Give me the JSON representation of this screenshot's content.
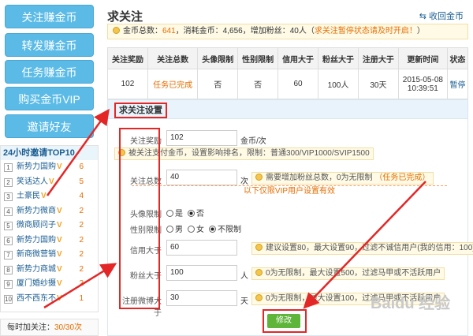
{
  "sidebar": {
    "buttons": [
      "关注赚金币",
      "转发赚金币",
      "任务赚金币",
      "购买金币VIP",
      "邀请好友"
    ],
    "top10_title": "24小时邀请TOP10",
    "top10": [
      {
        "rank": "1",
        "name": "新势力国购",
        "count": "6"
      },
      {
        "rank": "2",
        "name": "笑话达人",
        "count": "5"
      },
      {
        "rank": "3",
        "name": "土豪民",
        "count": "4"
      },
      {
        "rank": "4",
        "name": "新势力微商",
        "count": "2"
      },
      {
        "rank": "5",
        "name": "微商顾问子",
        "count": "2"
      },
      {
        "rank": "6",
        "name": "新势力国购",
        "count": "2"
      },
      {
        "rank": "7",
        "name": "新商微营销",
        "count": "2"
      },
      {
        "rank": "8",
        "name": "新势力商城",
        "count": "2"
      },
      {
        "rank": "9",
        "name": "厦门婚纱摄",
        "count": "2"
      },
      {
        "rank": "10",
        "name": "西不西东不",
        "count": "1"
      }
    ],
    "bottom_label": "每时加关注：",
    "bottom_value": "30/30次"
  },
  "header": {
    "title": "求关注",
    "back": "收回金币"
  },
  "summary": {
    "p1": "金币总数：",
    "total": "641",
    "p2": "，消耗金币：4,656，增加粉丝：40人（",
    "warn": "求关注暂停状态请及时开启！",
    "p3": "）"
  },
  "table": {
    "headers": [
      "关注奖励",
      "关注总数",
      "头像限制",
      "性别限制",
      "信用大于",
      "粉丝大于",
      "注册大于",
      "更新时间",
      "状态"
    ],
    "row": [
      "102",
      "任务已完成",
      "否",
      "否",
      "60",
      "100人",
      "30天",
      "2015-05-08 10:39:51",
      "暂停"
    ]
  },
  "form": {
    "title": "求关注设置",
    "reward_label": "关注奖励",
    "reward_value": "102",
    "reward_unit": "金币/次",
    "reward_tip": "被关注支付金币，设置影响排名，限制：普通300/VIP1000/SVIP1500",
    "total_label": "关注总数",
    "total_value": "40",
    "total_unit": "次",
    "total_tip": "需要增加粉丝总数，0为无限制",
    "total_status": "（任务已完成）",
    "vip_note": "以下仅限VIP用户设置有效",
    "avatar_label": "头像限制",
    "avatar_yes": "是",
    "avatar_no": "否",
    "gender_label": "性别限制",
    "gender_m": "男",
    "gender_f": "女",
    "gender_none": "不限制",
    "credit_label": "信用大于",
    "credit_value": "60",
    "credit_tip": "建议设置80，最大设置90，过滤不诚信用户(我的信用：100)",
    "fans_label": "粉丝大于",
    "fans_value": "100",
    "fans_unit": "人",
    "fans_tip": "0为无限制，最大设置500，过滤马甲或不活跃用户",
    "reg_label": "注册微博大于",
    "reg_value": "30",
    "reg_unit": "天",
    "reg_tip": "0为无限制，最大设置100，过滤马甲或不活跃用户",
    "submit": "修改"
  },
  "watermark": "Baidu 经验"
}
